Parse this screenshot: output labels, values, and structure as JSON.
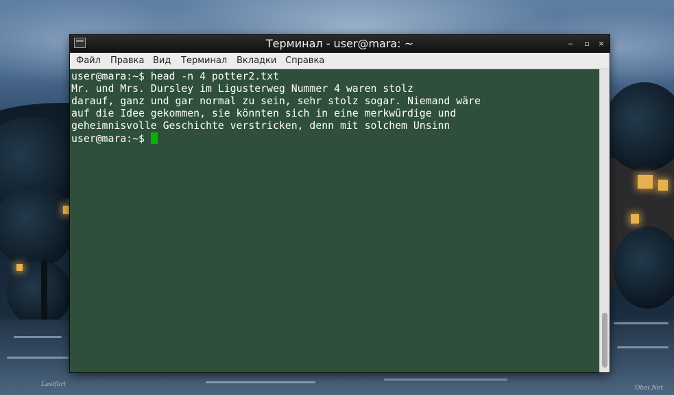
{
  "window": {
    "title": "Терминал - user@mara: ~",
    "minimize_glyph": "‒",
    "maximize_glyph": "▫",
    "close_glyph": "×"
  },
  "menu": {
    "items": [
      "Файл",
      "Правка",
      "Вид",
      "Терминал",
      "Вкладки",
      "Справка"
    ]
  },
  "terminal": {
    "lines": [
      "user@mara:~$ head -n 4 potter2.txt",
      "Mr. und Mrs. Dursley im Ligusterweg Nummer 4 waren stolz",
      "darauf, ganz und gar normal zu sein, sehr stolz sogar. Niemand wäre",
      "auf die Idee gekommen, sie könnten sich in eine merkwürdige und",
      "geheimnisvolle Geschichte verstricken, denn mit solchem Unsinn"
    ],
    "prompt": "user@mara:~$ ",
    "background_color": "#2f4f3a",
    "text_color": "#ffffff",
    "cursor_color": "#00b400"
  },
  "wallpaper": {
    "watermark_left": "Lastfort",
    "watermark_right": "Oboi.Net"
  }
}
